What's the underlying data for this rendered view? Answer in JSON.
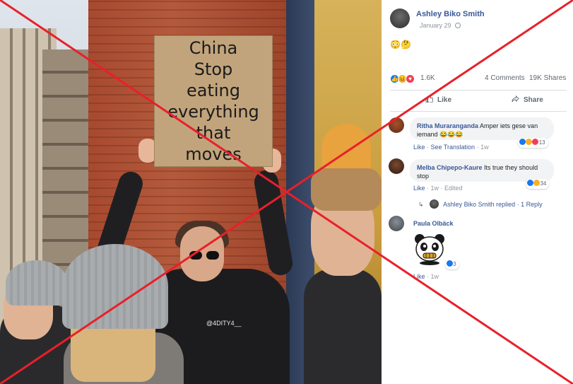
{
  "photo": {
    "sign_text": "China\nStop\neating\neverything\nthat\nmoves",
    "watermark": "@4DITY4__"
  },
  "post": {
    "author": "Ashley Biko Smith",
    "date": "January 29",
    "emojis": "😳🤔",
    "reactions": {
      "count": "1.6K",
      "comments": "4 Comments",
      "shares": "19K Shares"
    },
    "actions": {
      "like": "Like",
      "share": "Share"
    }
  },
  "comments": [
    {
      "name": "Ritha Muraranganda",
      "text": "Amper iets gese van iemand 😂😂😂",
      "like": "Like",
      "see_translation": "See Translation",
      "time": "1w",
      "reaction_count": "13"
    },
    {
      "name": "Melba Chipepo-Kaure",
      "text": "Its true they should stop",
      "like": "Like",
      "time": "1w",
      "edited": "Edited",
      "reaction_count": "34",
      "reply": {
        "author": "Ashley Biko Smith",
        "replied": "replied",
        "count": "1 Reply"
      }
    },
    {
      "name": "Paula Olbäck",
      "like": "Like",
      "time": "1w",
      "reaction_count": "3"
    }
  ],
  "colors": {
    "link_blue": "#385898",
    "like_blue": "#1877f2",
    "cross_red": "#e8202a"
  }
}
